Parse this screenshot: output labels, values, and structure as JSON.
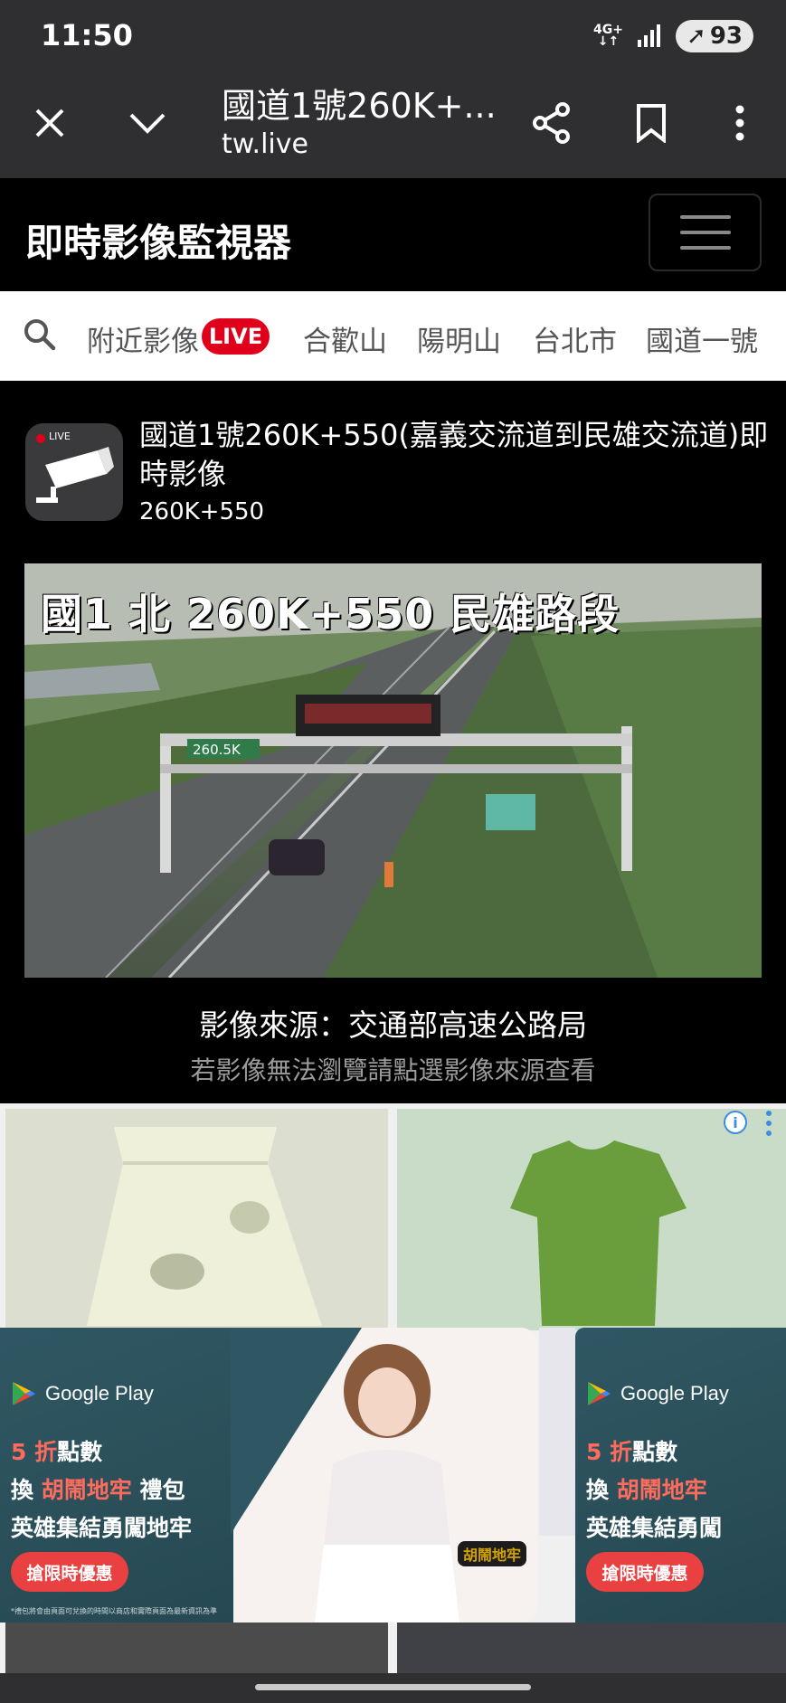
{
  "status_bar": {
    "time": "11:50",
    "network": "4G+",
    "battery": "93"
  },
  "browser": {
    "title": "國道1號260K+...",
    "url": "tw.live"
  },
  "site": {
    "title": "即時影像監視器"
  },
  "nav": {
    "items": [
      "附近影像",
      "合歡山",
      "陽明山",
      "台北市",
      "國道一號"
    ],
    "live_badge": "LIVE"
  },
  "camera": {
    "icon_badge": "LIVE",
    "title": "國道1號260K+550(嘉義交流道到民雄交流道)即時影像",
    "subtitle": "260K+550",
    "overlay_text": "國1 北 260K+550 民雄路段",
    "sign_label": "260.5K",
    "source": "影像來源：交通部高速公路局",
    "hint": "若影像無法瀏覽請點選影像來源查看"
  },
  "ad": {
    "store_name": "Google Play",
    "line1_prefix": "5 折",
    "line1_suffix": "點數",
    "line2_prefix": "換 ",
    "line2_accent": "胡鬧地牢",
    "line2_suffix": " 禮包",
    "line3": "英雄集結勇闖地牢",
    "cta": "搶限時優惠",
    "fine_print": "*禮包將會由頁面可兌換的時間以商店和實際頁面為最新資訊為準",
    "game_logo": "胡鬧地牢",
    "right_line2_accent": "胡鬧地牢",
    "right_line3": "英雄集結勇闖"
  },
  "colors": {
    "live_red": "#e0001b",
    "ad_cta_red": "#e94141",
    "ad_accent": "#ff6b5c",
    "chrome_bg": "#2f2f31"
  }
}
